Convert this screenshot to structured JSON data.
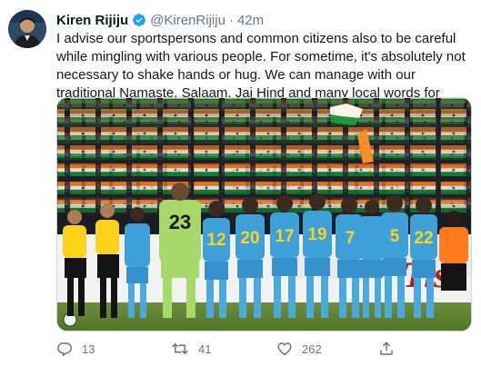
{
  "author": {
    "name": "Kiren Rijiju",
    "handle": "@KirenRijiju",
    "time": "42m",
    "verified": true
  },
  "tweet": {
    "text": "I advise our sportspersons and common citizens also to be careful while mingling with various people. For sometime, it's absolutely not necessary to shake hands or hug. We can manage with our traditional Namaste, Salaam, Jai Hind and many local words for greetings!"
  },
  "media": {
    "jersey_numbers": [
      "23",
      "12",
      "20",
      "17",
      "19",
      "7",
      "5",
      "22"
    ],
    "board_text": "Tiss"
  },
  "actions": {
    "reply_count": "13",
    "retweet_count": "41",
    "like_count": "262"
  },
  "icons": {
    "reply": "reply-icon",
    "retweet": "retweet-icon",
    "like": "heart-icon",
    "share": "share-icon",
    "verified": "verified-badge-icon"
  },
  "colors": {
    "verified_blue": "#1da1f2",
    "meta_gray": "#657786",
    "kit_blue": "#3ea0d8",
    "keeper_green": "#a8d86a",
    "saffron": "#ff8a2a",
    "flag_green": "#138808"
  }
}
